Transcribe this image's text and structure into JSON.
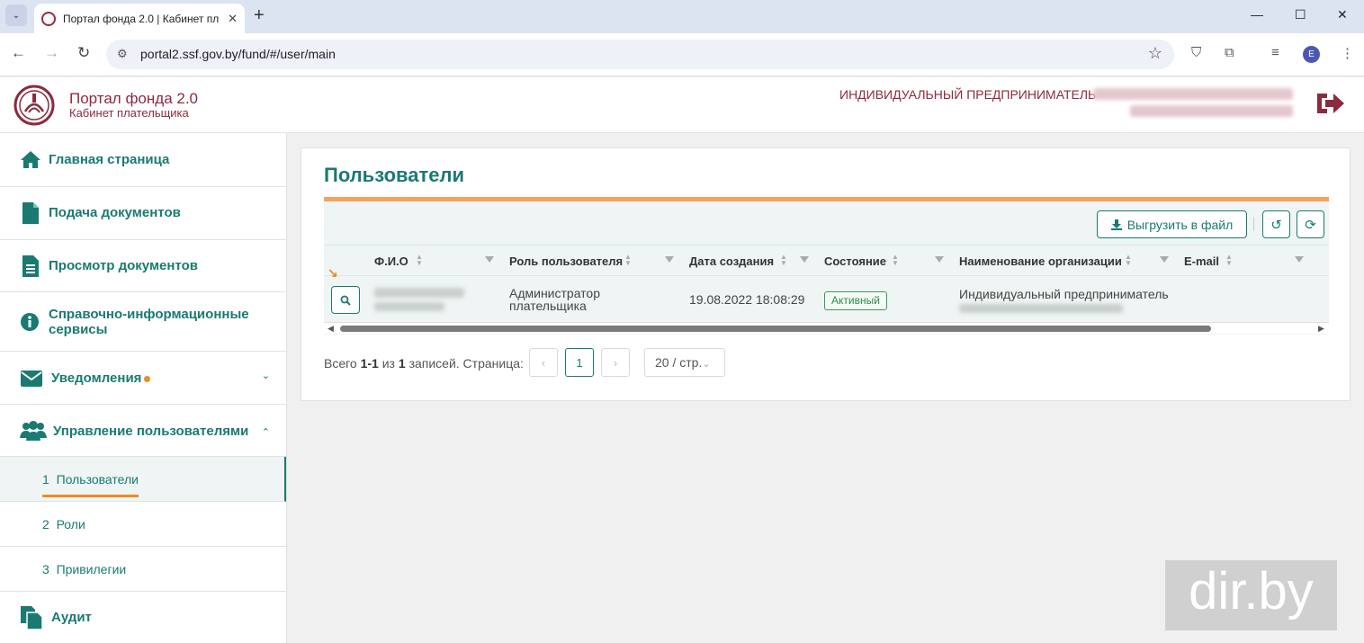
{
  "browser": {
    "tab_title": "Портал фонда 2.0 | Кабинет пл",
    "tab_close": "✕",
    "tab_menu": "⌄",
    "new_tab": "+",
    "url": "portal2.ssf.gov.by/fund/#/user/main",
    "profile_initial": "E",
    "win_min": "—",
    "win_max": "☐",
    "win_close": "✕"
  },
  "header": {
    "brand_title": "Портал фонда 2.0",
    "brand_subtitle": "Кабинет плательщика",
    "user_type": "ИНДИВИДУАЛЬНЫЙ ПРЕДПРИНИМАТЕЛЬ"
  },
  "sidebar": {
    "items": [
      {
        "label": "Главная страница",
        "icon": "home-icon"
      },
      {
        "label": "Подача документов",
        "icon": "document-icon"
      },
      {
        "label": "Просмотр документов",
        "icon": "document-text-icon"
      },
      {
        "label": "Справочно-информационные сервисы",
        "icon": "info-icon"
      },
      {
        "label": "Уведомления",
        "icon": "envelope-icon"
      },
      {
        "label": "Управление пользователями",
        "icon": "users-icon"
      },
      {
        "label": "Аудит",
        "icon": "copy-icon"
      }
    ],
    "subitems": [
      {
        "num": "1",
        "label": "Пользователи"
      },
      {
        "num": "2",
        "label": "Роли"
      },
      {
        "num": "3",
        "label": "Привилегии"
      }
    ],
    "chevron_down": "⌄",
    "chevron_up": "⌃"
  },
  "main": {
    "title": "Пользователи",
    "export_label": "Выгрузить в файл",
    "columns": [
      "Ф.И.О",
      "Роль пользователя",
      "Дата создания",
      "Состояние",
      "Наименование организации",
      "E-mail"
    ],
    "rows": [
      {
        "role_line1": "Администратор",
        "role_line2": "плательщика",
        "created": "19.08.2022 18:08:29",
        "status": "Активный",
        "org": "Индивидуальный предприниматель"
      }
    ],
    "pager": {
      "prefix": "Всего",
      "range": "1-1",
      "of": "из",
      "total": "1",
      "suffix": "записей. Страница:",
      "current_page": "1",
      "page_size": "20 / стр."
    }
  },
  "watermark": "dir.by",
  "colors": {
    "accent": "#1a7a72",
    "brand": "#8c2a3e",
    "highlight": "#f5a35c",
    "status": "#2e8a4d"
  }
}
